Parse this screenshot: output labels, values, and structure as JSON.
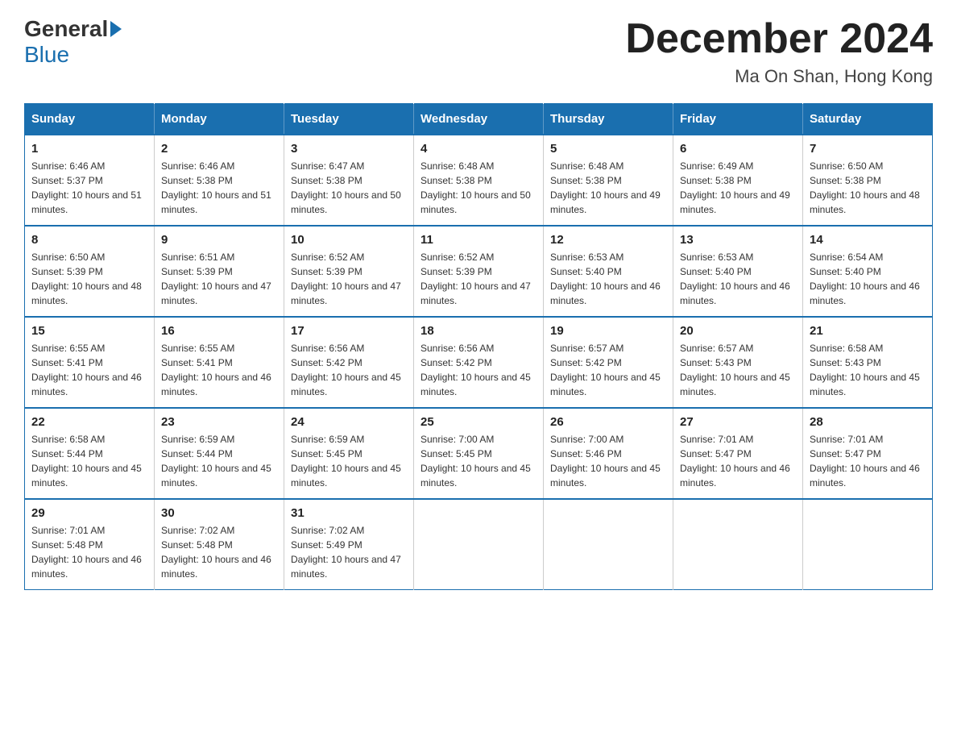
{
  "header": {
    "logo_general": "General",
    "logo_blue": "Blue",
    "month_title": "December 2024",
    "subtitle": "Ma On Shan, Hong Kong"
  },
  "calendar": {
    "days_of_week": [
      "Sunday",
      "Monday",
      "Tuesday",
      "Wednesday",
      "Thursday",
      "Friday",
      "Saturday"
    ],
    "weeks": [
      [
        {
          "day": "1",
          "sunrise": "6:46 AM",
          "sunset": "5:37 PM",
          "daylight": "10 hours and 51 minutes."
        },
        {
          "day": "2",
          "sunrise": "6:46 AM",
          "sunset": "5:38 PM",
          "daylight": "10 hours and 51 minutes."
        },
        {
          "day": "3",
          "sunrise": "6:47 AM",
          "sunset": "5:38 PM",
          "daylight": "10 hours and 50 minutes."
        },
        {
          "day": "4",
          "sunrise": "6:48 AM",
          "sunset": "5:38 PM",
          "daylight": "10 hours and 50 minutes."
        },
        {
          "day": "5",
          "sunrise": "6:48 AM",
          "sunset": "5:38 PM",
          "daylight": "10 hours and 49 minutes."
        },
        {
          "day": "6",
          "sunrise": "6:49 AM",
          "sunset": "5:38 PM",
          "daylight": "10 hours and 49 minutes."
        },
        {
          "day": "7",
          "sunrise": "6:50 AM",
          "sunset": "5:38 PM",
          "daylight": "10 hours and 48 minutes."
        }
      ],
      [
        {
          "day": "8",
          "sunrise": "6:50 AM",
          "sunset": "5:39 PM",
          "daylight": "10 hours and 48 minutes."
        },
        {
          "day": "9",
          "sunrise": "6:51 AM",
          "sunset": "5:39 PM",
          "daylight": "10 hours and 47 minutes."
        },
        {
          "day": "10",
          "sunrise": "6:52 AM",
          "sunset": "5:39 PM",
          "daylight": "10 hours and 47 minutes."
        },
        {
          "day": "11",
          "sunrise": "6:52 AM",
          "sunset": "5:39 PM",
          "daylight": "10 hours and 47 minutes."
        },
        {
          "day": "12",
          "sunrise": "6:53 AM",
          "sunset": "5:40 PM",
          "daylight": "10 hours and 46 minutes."
        },
        {
          "day": "13",
          "sunrise": "6:53 AM",
          "sunset": "5:40 PM",
          "daylight": "10 hours and 46 minutes."
        },
        {
          "day": "14",
          "sunrise": "6:54 AM",
          "sunset": "5:40 PM",
          "daylight": "10 hours and 46 minutes."
        }
      ],
      [
        {
          "day": "15",
          "sunrise": "6:55 AM",
          "sunset": "5:41 PM",
          "daylight": "10 hours and 46 minutes."
        },
        {
          "day": "16",
          "sunrise": "6:55 AM",
          "sunset": "5:41 PM",
          "daylight": "10 hours and 46 minutes."
        },
        {
          "day": "17",
          "sunrise": "6:56 AM",
          "sunset": "5:42 PM",
          "daylight": "10 hours and 45 minutes."
        },
        {
          "day": "18",
          "sunrise": "6:56 AM",
          "sunset": "5:42 PM",
          "daylight": "10 hours and 45 minutes."
        },
        {
          "day": "19",
          "sunrise": "6:57 AM",
          "sunset": "5:42 PM",
          "daylight": "10 hours and 45 minutes."
        },
        {
          "day": "20",
          "sunrise": "6:57 AM",
          "sunset": "5:43 PM",
          "daylight": "10 hours and 45 minutes."
        },
        {
          "day": "21",
          "sunrise": "6:58 AM",
          "sunset": "5:43 PM",
          "daylight": "10 hours and 45 minutes."
        }
      ],
      [
        {
          "day": "22",
          "sunrise": "6:58 AM",
          "sunset": "5:44 PM",
          "daylight": "10 hours and 45 minutes."
        },
        {
          "day": "23",
          "sunrise": "6:59 AM",
          "sunset": "5:44 PM",
          "daylight": "10 hours and 45 minutes."
        },
        {
          "day": "24",
          "sunrise": "6:59 AM",
          "sunset": "5:45 PM",
          "daylight": "10 hours and 45 minutes."
        },
        {
          "day": "25",
          "sunrise": "7:00 AM",
          "sunset": "5:45 PM",
          "daylight": "10 hours and 45 minutes."
        },
        {
          "day": "26",
          "sunrise": "7:00 AM",
          "sunset": "5:46 PM",
          "daylight": "10 hours and 45 minutes."
        },
        {
          "day": "27",
          "sunrise": "7:01 AM",
          "sunset": "5:47 PM",
          "daylight": "10 hours and 46 minutes."
        },
        {
          "day": "28",
          "sunrise": "7:01 AM",
          "sunset": "5:47 PM",
          "daylight": "10 hours and 46 minutes."
        }
      ],
      [
        {
          "day": "29",
          "sunrise": "7:01 AM",
          "sunset": "5:48 PM",
          "daylight": "10 hours and 46 minutes."
        },
        {
          "day": "30",
          "sunrise": "7:02 AM",
          "sunset": "5:48 PM",
          "daylight": "10 hours and 46 minutes."
        },
        {
          "day": "31",
          "sunrise": "7:02 AM",
          "sunset": "5:49 PM",
          "daylight": "10 hours and 47 minutes."
        },
        null,
        null,
        null,
        null
      ]
    ]
  }
}
